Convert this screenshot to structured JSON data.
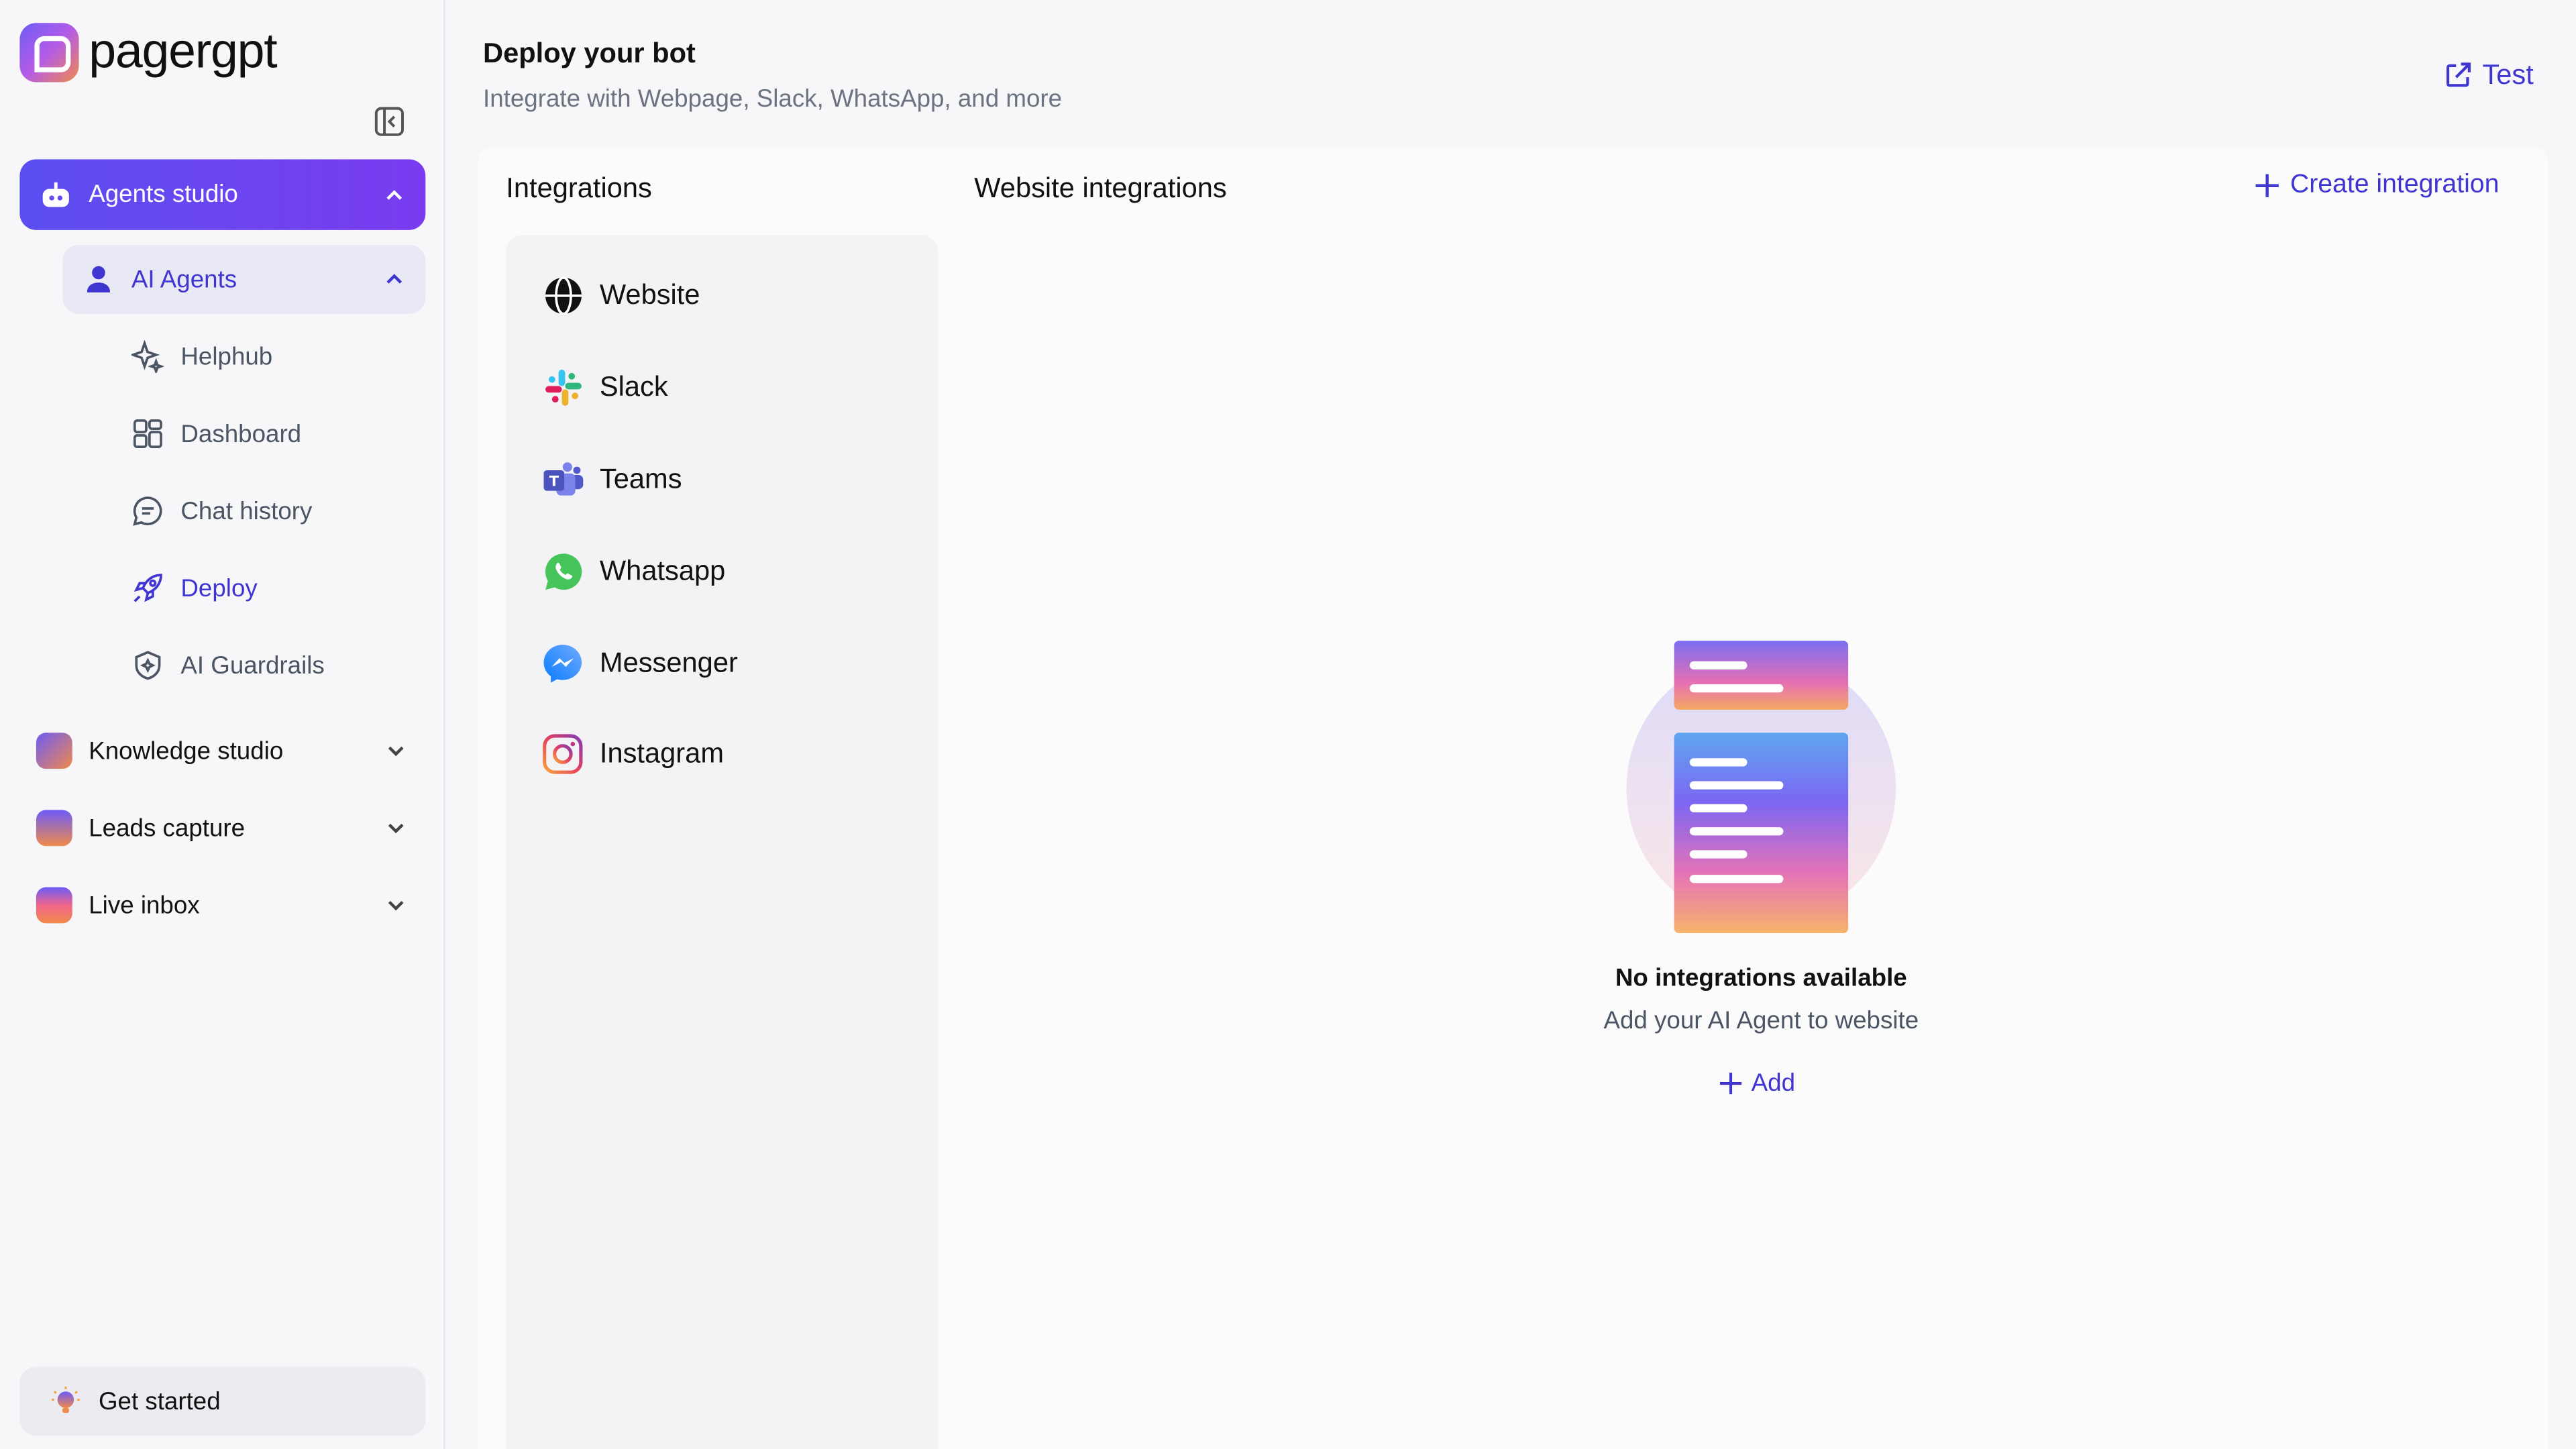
{
  "app": {
    "logo_text": "pagergpt"
  },
  "sidebar": {
    "main_item": {
      "label": "Agents studio",
      "icon": "robot-icon"
    },
    "sub_item": {
      "label": "AI Agents",
      "icon": "user-icon"
    },
    "leaf_items": [
      {
        "label": "Helphub",
        "icon": "sparkle-icon"
      },
      {
        "label": "Dashboard",
        "icon": "grid-icon"
      },
      {
        "label": "Chat history",
        "icon": "chat-icon"
      },
      {
        "label": "Deploy",
        "icon": "rocket-icon",
        "active": true
      },
      {
        "label": "AI Guardrails",
        "icon": "shield-icon"
      }
    ],
    "groups": [
      {
        "label": "Knowledge studio",
        "icon": "folder-icon"
      },
      {
        "label": "Leads capture",
        "icon": "contact-icon"
      },
      {
        "label": "Live inbox",
        "icon": "inbox-icon"
      }
    ],
    "get_started": "Get started"
  },
  "header": {
    "title": "Deploy your bot",
    "subtitle": "Integrate with Webpage, Slack, WhatsApp, and more",
    "test_label": "Test"
  },
  "integrations": {
    "title": "Integrations",
    "items": [
      {
        "label": "Website",
        "icon": "globe-icon"
      },
      {
        "label": "Slack",
        "icon": "slack-icon"
      },
      {
        "label": "Teams",
        "icon": "teams-icon"
      },
      {
        "label": "Whatsapp",
        "icon": "whatsapp-icon"
      },
      {
        "label": "Messenger",
        "icon": "messenger-icon"
      },
      {
        "label": "Instagram",
        "icon": "instagram-icon"
      }
    ]
  },
  "website_integrations": {
    "title": "Website integrations",
    "create_label": "Create integration",
    "empty_title": "No integrations available",
    "empty_subtitle": "Add your AI Agent to website",
    "add_label": "Add"
  },
  "colors": {
    "accent": "#3f35d1",
    "sidebar_active_start": "#5b4ef0",
    "sidebar_active_end": "#7a3cf0"
  }
}
